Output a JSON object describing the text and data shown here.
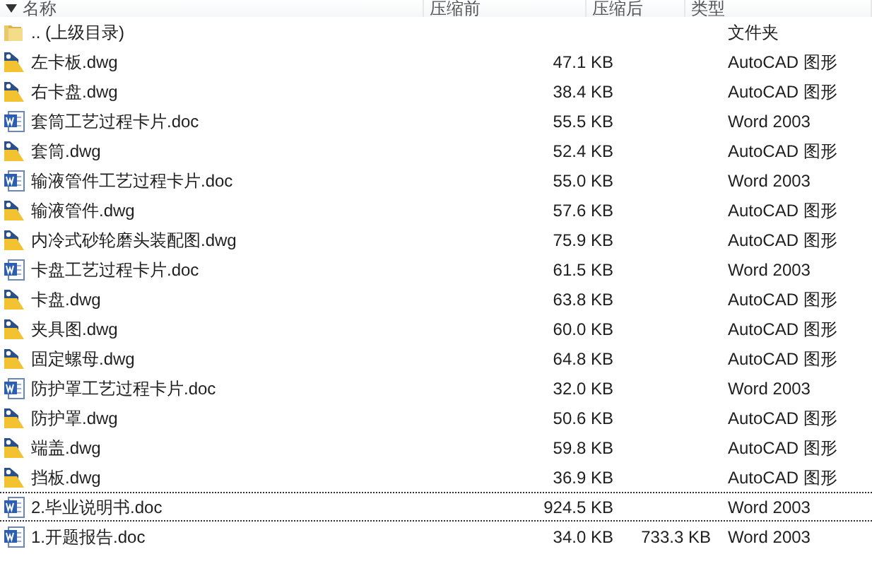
{
  "columns": [
    {
      "label": "名称",
      "sorted": true
    },
    {
      "label": "压缩前",
      "sorted": false
    },
    {
      "label": "压缩后",
      "sorted": false
    },
    {
      "label": "类型",
      "sorted": false
    }
  ],
  "rows": [
    {
      "kind": "folder",
      "name": ".. (上级目录)",
      "type": "文件夹",
      "focused": false
    },
    {
      "kind": "dwg",
      "name": "左卡板.dwg",
      "size": "47.1 KB",
      "type": "AutoCAD 图形",
      "focused": false
    },
    {
      "kind": "dwg",
      "name": "右卡盘.dwg",
      "size": "38.4 KB",
      "type": "AutoCAD 图形",
      "focused": false
    },
    {
      "kind": "doc",
      "name": "套筒工艺过程卡片.doc",
      "size": "55.5 KB",
      "type": "Word 2003",
      "focused": false
    },
    {
      "kind": "dwg",
      "name": "套筒.dwg",
      "size": "52.4 KB",
      "type": "AutoCAD 图形",
      "focused": false
    },
    {
      "kind": "doc",
      "name": "输液管件工艺过程卡片.doc",
      "size": "55.0 KB",
      "type": "Word 2003",
      "focused": false
    },
    {
      "kind": "dwg",
      "name": "输液管件.dwg",
      "size": "57.6 KB",
      "type": "AutoCAD 图形",
      "focused": false
    },
    {
      "kind": "dwg",
      "name": "内冷式砂轮磨头装配图.dwg",
      "size": "75.9 KB",
      "type": "AutoCAD 图形",
      "focused": false
    },
    {
      "kind": "doc",
      "name": "卡盘工艺过程卡片.doc",
      "size": "61.5 KB",
      "type": "Word 2003",
      "focused": false
    },
    {
      "kind": "dwg",
      "name": "卡盘.dwg",
      "size": "63.8 KB",
      "type": "AutoCAD 图形",
      "focused": false
    },
    {
      "kind": "dwg",
      "name": "夹具图.dwg",
      "size": "60.0 KB",
      "type": "AutoCAD 图形",
      "focused": false
    },
    {
      "kind": "dwg",
      "name": "固定螺母.dwg",
      "size": "64.8 KB",
      "type": "AutoCAD 图形",
      "focused": false
    },
    {
      "kind": "doc",
      "name": "防护罩工艺过程卡片.doc",
      "size": "32.0 KB",
      "type": "Word 2003",
      "focused": false
    },
    {
      "kind": "dwg",
      "name": "防护罩.dwg",
      "size": "50.6 KB",
      "type": "AutoCAD 图形",
      "focused": false
    },
    {
      "kind": "dwg",
      "name": "端盖.dwg",
      "size": "59.8 KB",
      "type": "AutoCAD 图形",
      "focused": false
    },
    {
      "kind": "dwg",
      "name": "挡板.dwg",
      "size": "36.9 KB",
      "type": "AutoCAD 图形",
      "focused": false
    },
    {
      "kind": "doc",
      "name": "2.毕业说明书.doc",
      "size": "924.5 KB",
      "type": "Word 2003",
      "focused": true
    },
    {
      "kind": "doc",
      "name": "1.开题报告.doc",
      "size": "34.0 KB",
      "packed": "733.3 KB",
      "type": "Word 2003",
      "focused": false
    }
  ]
}
